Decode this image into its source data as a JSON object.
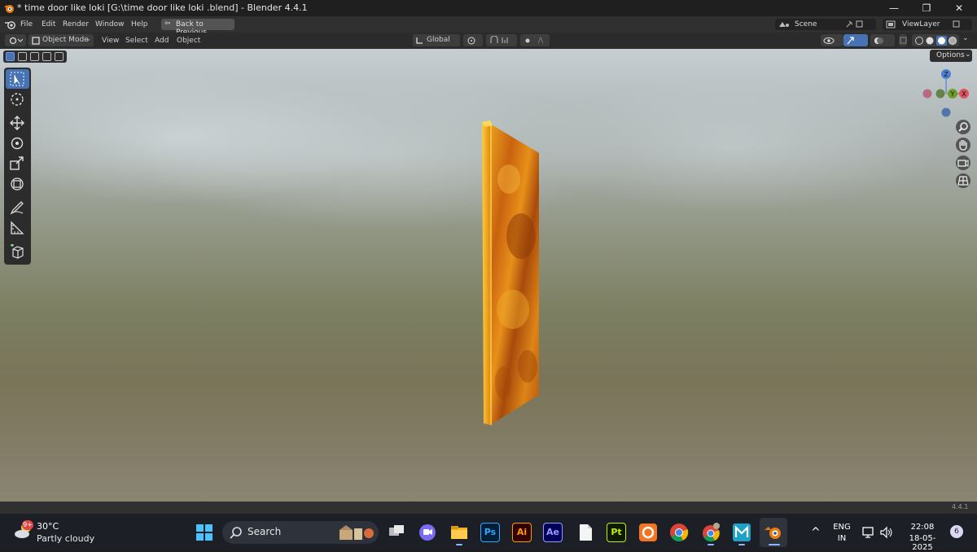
{
  "window": {
    "title": "* time door like loki  [G:\\time door like loki .blend] - Blender 4.4.1",
    "minimize_glyph": "—",
    "maximize_glyph": "❐",
    "close_glyph": "✕"
  },
  "menu": {
    "items": [
      "File",
      "Edit",
      "Render",
      "Window",
      "Help"
    ],
    "back_button": "Back to Previous",
    "scene_label": "Scene",
    "view_layer_label": "ViewLayer"
  },
  "viewport_header": {
    "mode": "Object Mode",
    "menus": [
      "View",
      "Select",
      "Add",
      "Object"
    ],
    "transform_orientation": "Global",
    "options_button": "Options"
  },
  "gizmo": {
    "axis_z": "Z",
    "axis_y": "Y",
    "axis_x": "X"
  },
  "status": {
    "version": "4.4.1"
  },
  "taskbar": {
    "weather_temp": "30°C",
    "weather_desc": "Partly cloudy",
    "weather_badge": "9+",
    "search_label": "Search",
    "apps": [
      {
        "name": "Ps",
        "color": "#31a8ff",
        "bg": "#001e36"
      },
      {
        "name": "Ai",
        "color": "#ff9a00",
        "bg": "#330000"
      },
      {
        "name": "Ae",
        "color": "#9999ff",
        "bg": "#00005b"
      },
      {
        "name": "Pt",
        "color": "#c4f000",
        "bg": "#0d1a00"
      }
    ],
    "language": "ENG",
    "region": "IN",
    "time": "22:08",
    "date": "18-05-2025",
    "notification_count": "6",
    "tray_chevron": "^"
  },
  "colors": {
    "accent": "#4772b3",
    "door_primary": "#e08a14",
    "door_dark": "#a4470a",
    "door_edge": "#ffc83a"
  }
}
